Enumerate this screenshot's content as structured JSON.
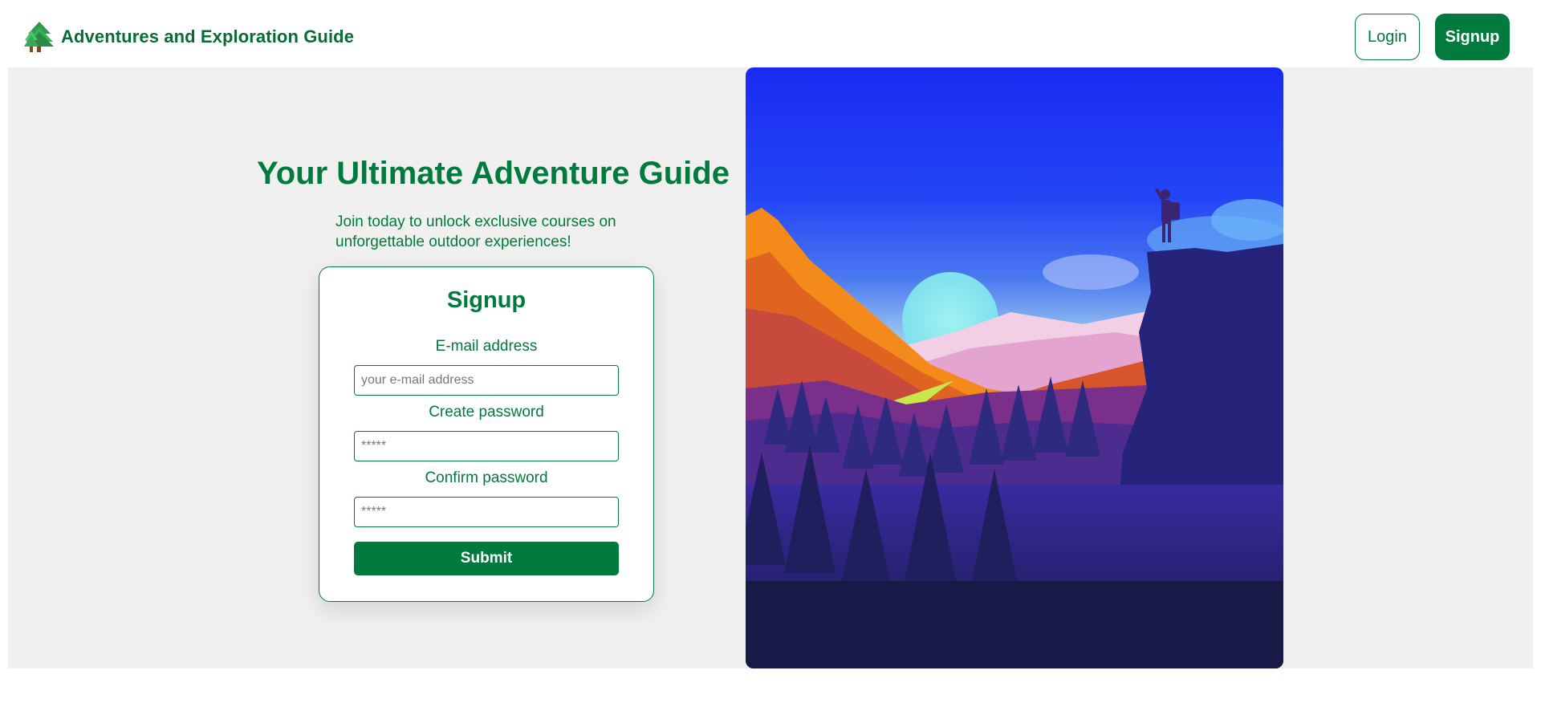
{
  "header": {
    "brand_icon": "tree-icon",
    "brand_title": "Adventures and Exploration Guide",
    "login_label": "Login",
    "signup_label": "Signup"
  },
  "hero": {
    "title": "Your Ultimate Adventure Guide",
    "subtitle": "Join today to unlock exclusive courses on unforgettable outdoor experiences!",
    "image_subject": "hiker-on-cliff-sunset-illustration"
  },
  "signup_form": {
    "title": "Signup",
    "email_label": "E-mail address",
    "email_placeholder": "your e-mail address",
    "password_label": "Create password",
    "password_placeholder": "*****",
    "confirm_label": "Confirm password",
    "confirm_placeholder": "*****",
    "submit_label": "Submit"
  },
  "colors": {
    "brand_green": "#007a3d",
    "background": "#f0f0f0",
    "card_background": "#ffffff"
  }
}
